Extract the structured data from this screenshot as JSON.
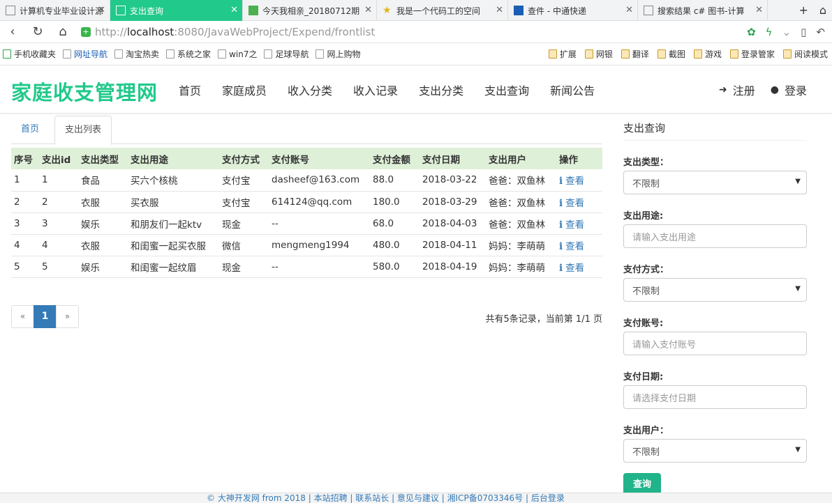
{
  "browser": {
    "tabs": [
      {
        "label": "计算机专业毕业设计源",
        "icon": "page-icon",
        "active": false
      },
      {
        "label": "支出查询",
        "icon": "page-icon",
        "active": true
      },
      {
        "label": "今天我相亲_20180712期",
        "icon": "video-icon",
        "active": false
      },
      {
        "label": "我是一个代码工的空间",
        "icon": "star-icon",
        "active": false
      },
      {
        "label": "查件 - 中通快递",
        "icon": "zto-icon",
        "active": false
      },
      {
        "label": "搜索结果 c# 图书-计算",
        "icon": "page-icon",
        "active": false
      }
    ],
    "url": {
      "scheme": "http://",
      "host": "localhost",
      "rest": ":8080/JavaWebProject/Expend/frontlist"
    },
    "bookmarks_left": [
      "手机收藏夹",
      "网址导航",
      "淘宝热卖",
      "系统之家",
      "win7之",
      "足球导航",
      "网上购物"
    ],
    "bookmarks_right": [
      "扩展",
      "网银",
      "翻译",
      "截图",
      "游戏",
      "登录管家",
      "阅读模式"
    ]
  },
  "site": {
    "logo": "家庭收支管理网",
    "nav": [
      "首页",
      "家庭成员",
      "收入分类",
      "收入记录",
      "支出分类",
      "支出查询",
      "新闻公告"
    ],
    "register": "注册",
    "login": "登录"
  },
  "content_tabs": {
    "home": "首页",
    "list": "支出列表"
  },
  "table": {
    "headers": [
      "序号",
      "支出id",
      "支出类型",
      "支出用途",
      "支付方式",
      "支付账号",
      "支付金额",
      "支付日期",
      "支出用户",
      "操作"
    ],
    "rows": [
      [
        "1",
        "1",
        "食品",
        "买六个核桃",
        "支付宝",
        "dasheef@163.com",
        "88.0",
        "2018-03-22",
        "爸爸：双鱼林",
        "查看"
      ],
      [
        "2",
        "2",
        "衣服",
        "买衣服",
        "支付宝",
        "614124@qq.com",
        "180.0",
        "2018-03-29",
        "爸爸：双鱼林",
        "查看"
      ],
      [
        "3",
        "3",
        "娱乐",
        "和朋友们一起ktv",
        "现金",
        "--",
        "68.0",
        "2018-04-03",
        "爸爸：双鱼林",
        "查看"
      ],
      [
        "4",
        "4",
        "衣服",
        "和闺蜜一起买衣服",
        "微信",
        "mengmeng1994",
        "480.0",
        "2018-04-11",
        "妈妈：李萌萌",
        "查看"
      ],
      [
        "5",
        "5",
        "娱乐",
        "和闺蜜一起纹眉",
        "现金",
        "--",
        "580.0",
        "2018-04-19",
        "妈妈：李萌萌",
        "查看"
      ]
    ]
  },
  "pagination": {
    "prev": "«",
    "current": "1",
    "next": "»",
    "info": "共有5条记录，当前第 1/1 页"
  },
  "search": {
    "title": "支出查询",
    "type_label": "支出类型：",
    "type_value": "不限制",
    "purpose_label": "支出用途:",
    "purpose_placeholder": "请输入支出用途",
    "method_label": "支付方式：",
    "method_value": "不限制",
    "account_label": "支付账号:",
    "account_placeholder": "请输入支付账号",
    "date_label": "支付日期:",
    "date_placeholder": "请选择支付日期",
    "user_label": "支出用户：",
    "user_value": "不限制",
    "submit": "查询"
  },
  "footer": "© 大神开发网 from 2018 | 本站招聘 | 联系站长 | 意见与建议 | 湘ICP备0703346号 | 后台登录",
  "colors": {
    "accent": "#21c98b",
    "link": "#337ab7",
    "table_header": "#dff0d8"
  }
}
